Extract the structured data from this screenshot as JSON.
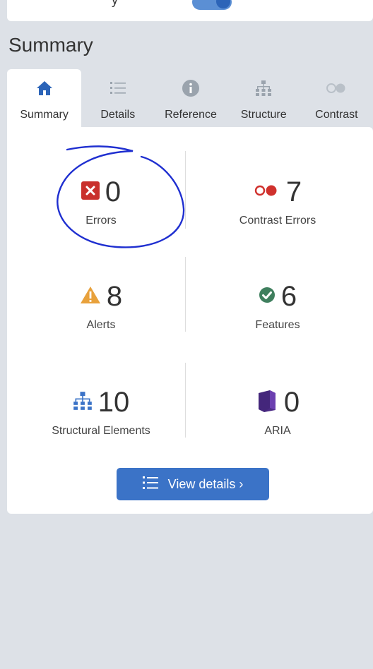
{
  "top": {
    "cut_text": "y"
  },
  "section": {
    "title": "Summary"
  },
  "tabs": [
    {
      "label": "Summary",
      "icon": "home-icon",
      "active": true
    },
    {
      "label": "Details",
      "icon": "list-icon",
      "active": false
    },
    {
      "label": "Reference",
      "icon": "info-icon",
      "active": false
    },
    {
      "label": "Structure",
      "icon": "hierarchy-icon",
      "active": false
    },
    {
      "label": "Contrast",
      "icon": "contrast-icon",
      "active": false
    }
  ],
  "summary": {
    "errors": {
      "value": "0",
      "label": "Errors"
    },
    "contrast_errors": {
      "value": "7",
      "label": "Contrast Errors"
    },
    "alerts": {
      "value": "8",
      "label": "Alerts"
    },
    "features": {
      "value": "6",
      "label": "Features"
    },
    "structural": {
      "value": "10",
      "label": "Structural Elements"
    },
    "aria": {
      "value": "0",
      "label": "ARIA"
    }
  },
  "button": {
    "label": "View details ›"
  },
  "colors": {
    "accent": "#3b73c7",
    "error": "#c9302c",
    "alert": "#e8a13c",
    "feature": "#3f7f5e",
    "aria": "#4b2a84",
    "annotation": "#1f2fd0"
  }
}
